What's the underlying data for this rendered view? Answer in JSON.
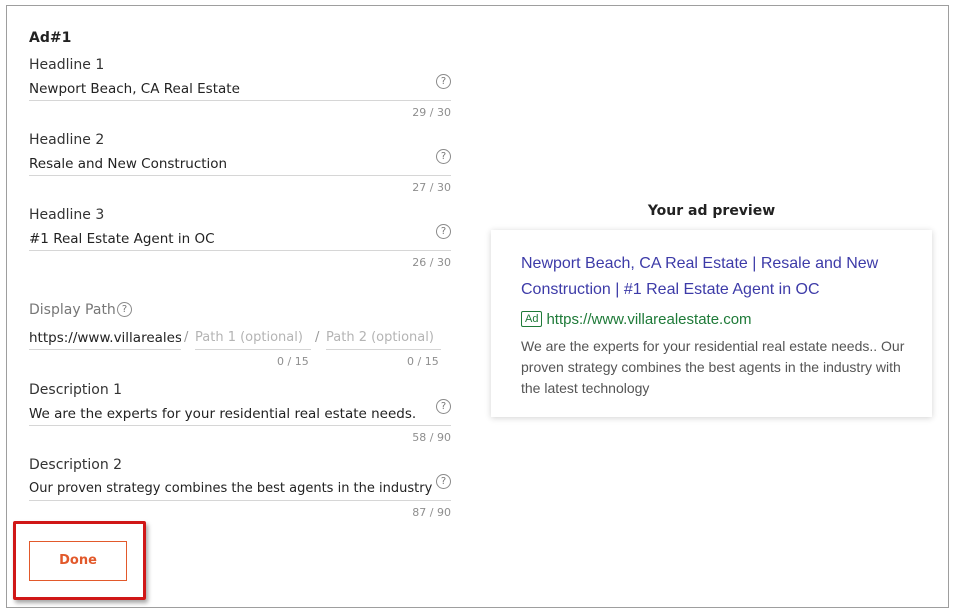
{
  "ad": {
    "title": "Ad#1",
    "headline1": {
      "label": "Headline 1",
      "value": "Newport Beach, CA Real Estate",
      "counter": "29 / 30"
    },
    "headline2": {
      "label": "Headline 2",
      "value": "Resale and New Construction",
      "counter": "27 / 30"
    },
    "headline3": {
      "label": "Headline 3",
      "value": "#1 Real Estate Agent in OC",
      "counter": "26 / 30"
    },
    "display_path": {
      "label": "Display Path",
      "base": "https://www.villareales",
      "separator": "/",
      "path1_placeholder": "Path 1 (optional)",
      "path2_placeholder": "Path 2 (optional)",
      "path1_counter": "0 / 15",
      "path2_counter": "0 / 15"
    },
    "description1": {
      "label": "Description 1",
      "value": "We are the experts for your residential real estate needs.",
      "counter": "58 / 90"
    },
    "description2": {
      "label": "Description 2",
      "value": "Our proven strategy combines the best agents in the industry",
      "counter": "87 / 90"
    },
    "help_glyph": "?",
    "help_icon": "question-circle-icon",
    "done_label": "Done"
  },
  "preview": {
    "title": "Your ad preview",
    "headline": "Newport Beach, CA Real Estate | Resale and New Construction | #1 Real Estate Agent in OC",
    "badge": "Ad",
    "url": "https://www.villarealestate.com",
    "description": "We are the experts for your residential real estate needs.. Our proven strategy combines the best agents in the industry with the latest technology"
  },
  "colors": {
    "accent": "#e2592b",
    "highlight": "#d01717",
    "headline_link": "#3d3ba8",
    "url_green": "#1e7a38"
  }
}
